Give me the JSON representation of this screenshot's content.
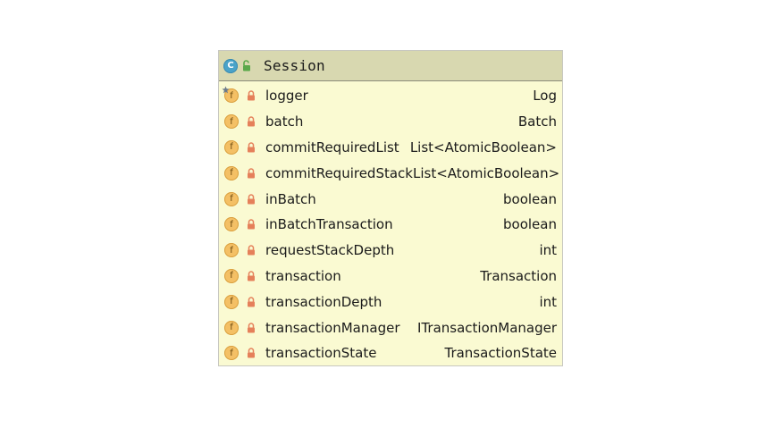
{
  "class": {
    "name": "Session",
    "icon": "class-icon",
    "visibility_icon": "public-unlock-icon",
    "header_color": "#d8d8b0",
    "body_color": "#fafad2"
  },
  "fields": [
    {
      "name": "logger",
      "type": "Log",
      "icon": "field-icon",
      "static": true
    },
    {
      "name": "batch",
      "type": "Batch",
      "icon": "field-icon",
      "static": false
    },
    {
      "name": "commitRequiredList",
      "type": "List<AtomicBoolean>",
      "icon": "field-icon",
      "static": false
    },
    {
      "name": "commitRequiredStack",
      "type": "List<AtomicBoolean>",
      "icon": "field-icon",
      "static": false
    },
    {
      "name": "inBatch",
      "type": "boolean",
      "icon": "field-icon",
      "static": false
    },
    {
      "name": "inBatchTransaction",
      "type": "boolean",
      "icon": "field-icon",
      "static": false
    },
    {
      "name": "requestStackDepth",
      "type": "int",
      "icon": "field-icon",
      "static": false
    },
    {
      "name": "transaction",
      "type": "Transaction",
      "icon": "field-icon",
      "static": false
    },
    {
      "name": "transactionDepth",
      "type": "int",
      "icon": "field-icon",
      "static": false
    },
    {
      "name": "transactionManager",
      "type": "ITransactionManager",
      "icon": "field-icon",
      "static": false
    },
    {
      "name": "transactionState",
      "type": "TransactionState",
      "icon": "field-icon",
      "static": false
    }
  ]
}
